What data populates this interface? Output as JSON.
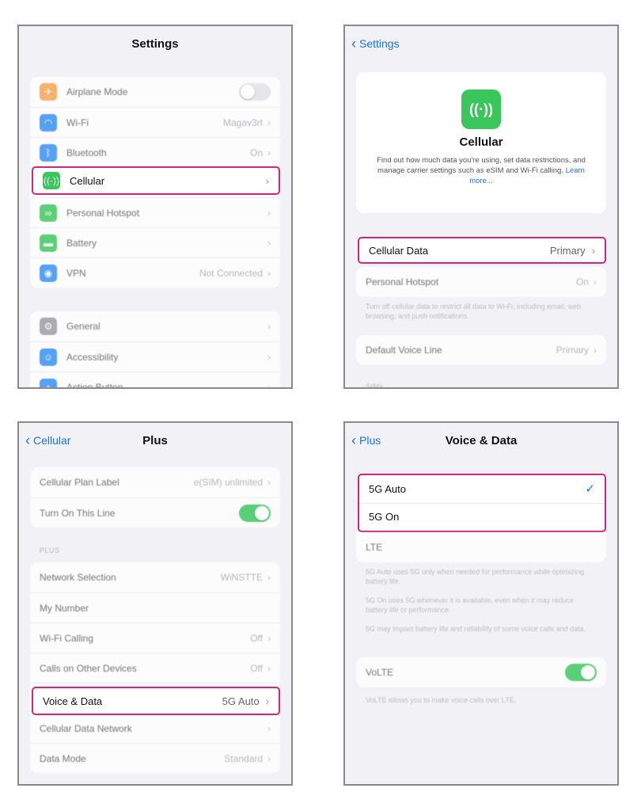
{
  "panel1": {
    "title": "Settings",
    "rows1": [
      {
        "label": "Airplane Mode",
        "value": "",
        "icon": "airplane-icon"
      },
      {
        "label": "Wi-Fi",
        "value": "Magav3rt",
        "icon": "wifi-icon"
      },
      {
        "label": "Bluetooth",
        "value": "On",
        "icon": "bluetooth-icon"
      },
      {
        "label": "Cellular",
        "value": "",
        "icon": "antenna-icon"
      },
      {
        "label": "Personal Hotspot",
        "value": "",
        "icon": "hotspot-icon"
      },
      {
        "label": "Battery",
        "value": "",
        "icon": "battery-icon"
      },
      {
        "label": "VPN",
        "value": "Not Connected",
        "icon": "vpn-icon"
      }
    ],
    "rows2": [
      {
        "label": "General",
        "icon": "gear-icon"
      },
      {
        "label": "Accessibility",
        "icon": "accessibility-icon"
      },
      {
        "label": "Action Button",
        "icon": "action-button-icon"
      }
    ]
  },
  "panel2": {
    "back": "Settings",
    "hero_title": "Cellular",
    "hero_desc": "Find out how much data you're using, set data restrictions, and manage carrier settings such as eSIM and Wi-Fi calling.",
    "hero_link": "Learn more...",
    "cellular_data_label": "Cellular Data",
    "cellular_data_value": "Primary",
    "hotspot_label": "Personal Hotspot",
    "hotspot_value": "On",
    "footnote": "Turn off cellular data to restrict all data to Wi-Fi, including email, web browsing, and push notifications.",
    "voice_line_label": "Default Voice Line",
    "voice_line_value": "Primary",
    "section_cut": "SIMs"
  },
  "panel3": {
    "back": "Cellular",
    "title": "Plus",
    "plan_label": "Cellular Plan Label",
    "plan_value": "e(SIM) unlimited",
    "line_label": "Turn On This Line",
    "section": "PLUS",
    "rows": [
      {
        "label": "Network Selection",
        "value": "WiNSTTE"
      },
      {
        "label": "My Number",
        "value": ""
      },
      {
        "label": "Wi-Fi Calling",
        "value": "Off"
      },
      {
        "label": "Calls on Other Devices",
        "value": "Off"
      }
    ],
    "voice_label": "Voice & Data",
    "voice_value": "5G Auto",
    "rows_after": [
      {
        "label": "Cellular Data Network",
        "value": ""
      },
      {
        "label": "Data Mode",
        "value": "Standard"
      }
    ]
  },
  "panel4": {
    "back": "Plus",
    "title": "Voice & Data",
    "opt1": "5G Auto",
    "opt2": "5G On",
    "opt3": "LTE",
    "note1": "5G Auto uses 5G only when needed for performance while optimizing battery life.",
    "note2": "5G On uses 5G whenever it is available, even when it may reduce battery life or performance.",
    "note3": "5G may impact battery life and reliability of some voice calls and data.",
    "volte_label": "VoLTE",
    "volte_note": "VoLTE allows you to make voice calls over LTE."
  },
  "colors": {
    "highlight": "#d1267b",
    "accent": "#1a73e8",
    "toggle_on": "#35c759"
  }
}
